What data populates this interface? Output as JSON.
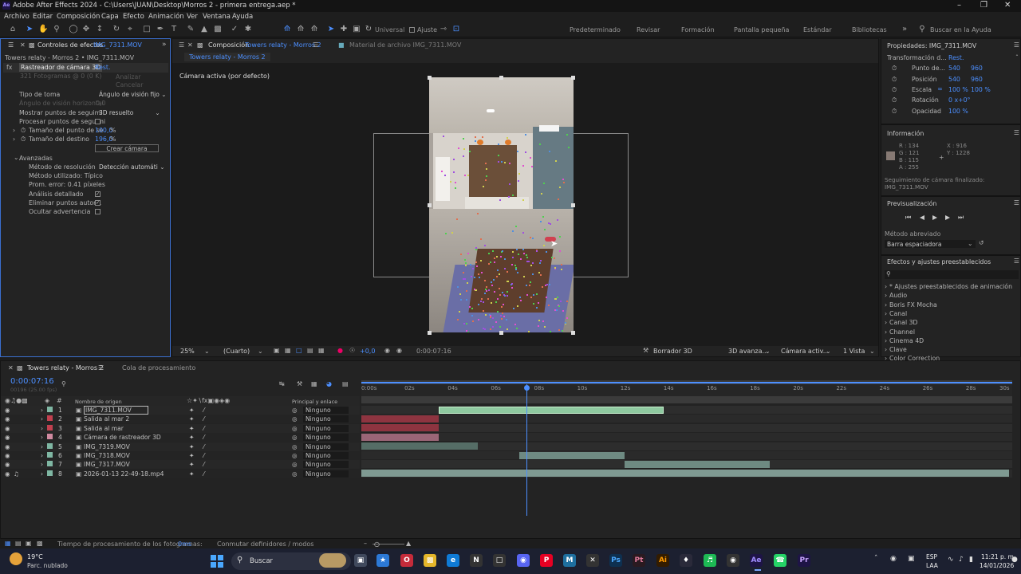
{
  "window": {
    "title": "Adobe After Effects 2024 - C:\\Users\\JUAN\\Desktop\\Morros 2 - primera entrega.aep *",
    "app_icon": "Ae"
  },
  "menu": [
    "Archivo",
    "Editar",
    "Composición",
    "Capa",
    "Efecto",
    "Animación",
    "Ver",
    "Ventana",
    "Ayuda"
  ],
  "toolbar": {
    "universal_label": "Universal",
    "ajuste_label": "Ajuste",
    "workspaces": [
      "Predeterminado",
      "Revisar",
      "Formación",
      "Pantalla pequeña",
      "Estándar",
      "Bibliotecas"
    ],
    "search_placeholder": "Buscar en la Ayuda"
  },
  "effects_panel": {
    "tab_label": "Controles de efectos",
    "tab_file": "IMG_7311.MOV",
    "breadcrumb": "Towers relaty - Morros 2 • IMG_7311.MOV",
    "effect_name": "Rastreador de cámara 3D",
    "reset": "Rest.",
    "analyze_info": "321 Fotogramas @ 0 (0 K)",
    "analizar": "Analizar",
    "cancelar": "Cancelar",
    "tipo_toma_label": "Tipo de toma",
    "tipo_toma_value": "Ángulo de visión fijo",
    "angulo_label": "Ángulo de visión horizontal",
    "angulo_value": "0,0",
    "mostrar_label": "Mostrar puntos de seguimi",
    "mostrar_value": "3D resuelto",
    "procesar_label": "Procesar puntos de seguimi",
    "tamano_punto_label": "Tamaño del punto de se",
    "tamano_punto_value": "100,0",
    "tamano_destino_label": "Tamaño del destino",
    "tamano_destino_value": "196,0",
    "percent": "%",
    "crear_camara": "Crear cámara",
    "avanzadas": "Avanzadas",
    "metodo_res_label": "Método de resolución",
    "metodo_res_value": "Detección automáti",
    "metodo_usado": "Método utilizado: Típico",
    "prom_error": "Prom. error: 0.41 píxeles",
    "analisis": "Análisis detallado",
    "eliminar": "Eliminar puntos autom.",
    "ocultar": "Ocultar advertencia"
  },
  "composition": {
    "tab_label": "Composición",
    "tab_comp": "Towers relaty - Morros 2",
    "material": "Material de archivo  IMG_7311.MOV",
    "sub_tab": "Towers relaty - Morros 2",
    "camera_label": "Cámara activa (por defecto)",
    "zoom": "25%",
    "resolution": "(Cuarto)",
    "exposure": "+0,0",
    "timecode": "0:00:07:16",
    "renderer": "Borrador 3D",
    "view3d": "3D avanza...",
    "camera_select": "Cámara activ...",
    "views": "1 Vista"
  },
  "properties": {
    "title": "Propiedades: IMG_7311.MOV",
    "transform": "Transformación d...",
    "reset": "Rest.",
    "punto_label": "Punto de...",
    "punto_x": "540",
    "punto_y": "960",
    "pos_label": "Posición",
    "pos_x": "540",
    "pos_y": "960",
    "escala_label": "Escala",
    "escala_x": "100 %",
    "escala_y": "100 %",
    "rot_label": "Rotación",
    "rot_value": "0 x+0°",
    "opac_label": "Opacidad",
    "opac_value": "100 %"
  },
  "info": {
    "title": "Información",
    "r": "R : 134",
    "g": "G : 121",
    "b": "B : 115",
    "a": "A : 255",
    "x": "X : 916",
    "y": "Y : 1228",
    "swatch_color": "#867973",
    "msg1": "Seguimiento de cámara finalizado:",
    "msg2": "IMG_7311.MOV"
  },
  "preview": {
    "title": "Previsualización",
    "metodo_label": "Método abreviado",
    "metodo_value": "Barra espaciadora"
  },
  "effects_presets": {
    "title": "Efectos y ajustes preestablecidos",
    "items": [
      "* Ajustes preestablecidos de animación",
      "Audio",
      "Boris FX Mocha",
      "Canal",
      "Canal 3D",
      "Channel",
      "Cinema 4D",
      "Clave",
      "Color Correction"
    ]
  },
  "timeline": {
    "tab_label": "Towers relaty - Morros 2",
    "queue_label": "Cola de procesamiento",
    "timecode": "0:00:07:16",
    "frames": "00196 (25.00 fps)",
    "col_name": "Nombre de origen",
    "col_parent": "Principal y enlace",
    "ruler": [
      "0:00s",
      "02s",
      "04s",
      "06s",
      "08s",
      "10s",
      "12s",
      "14s",
      "16s",
      "18s",
      "20s",
      "22s",
      "24s",
      "26s",
      "28s",
      "30s"
    ],
    "playhead_seconds": 7.64,
    "duration_seconds": 30,
    "layers": [
      {
        "num": "1",
        "name": "IMG_7311.MOV",
        "parent": "Ninguno",
        "label": "#7fb7a3",
        "bar_color": "#8fc9a0",
        "start": 3.6,
        "end": 14.0,
        "selected": true
      },
      {
        "num": "2",
        "name": "Salida al mar 2",
        "parent": "Ninguno",
        "label": "#c2404f",
        "bar_color": "#8e3440",
        "start": 0,
        "end": 3.6
      },
      {
        "num": "3",
        "name": "Salida al mar",
        "parent": "Ninguno",
        "label": "#c2404f",
        "bar_color": "#8e3440",
        "start": 0,
        "end": 3.6
      },
      {
        "num": "4",
        "name": "Cámara de rastreador 3D",
        "parent": "Ninguno",
        "label": "#d08aa0",
        "bar_color": "#9a6677",
        "start": 0,
        "end": 3.6
      },
      {
        "num": "5",
        "name": "IMG_7319.MOV",
        "parent": "Ninguno",
        "label": "#7fb7a3",
        "bar_color": "#556d66",
        "start": 0,
        "end": 5.4
      },
      {
        "num": "6",
        "name": "IMG_7318.MOV",
        "parent": "Ninguno",
        "label": "#7fb7a3",
        "bar_color": "#6e8a82",
        "start": 7.3,
        "end": 12.2
      },
      {
        "num": "7",
        "name": "IMG_7317.MOV",
        "parent": "Ninguno",
        "label": "#7fb7a3",
        "bar_color": "#6e8a82",
        "start": 12.2,
        "end": 18.9
      },
      {
        "num": "8",
        "name": "2026-01-13 22-49-18.mp4",
        "parent": "Ninguno",
        "label": "#7fb7a3",
        "bar_color": "#7f9a92",
        "start": 0,
        "end": 30
      }
    ],
    "render_time_label": "Tiempo de procesamiento de los fotogramas:",
    "render_time_value": "0ms",
    "toggle_label": "Conmutar definidores / modos"
  },
  "taskbar": {
    "weather_temp": "19°C",
    "weather_desc": "Parc. nublado",
    "search": "Buscar",
    "lang1": "ESP",
    "lang2": "LAA",
    "time": "11:21 p. m.",
    "date": "14/01/2026"
  }
}
